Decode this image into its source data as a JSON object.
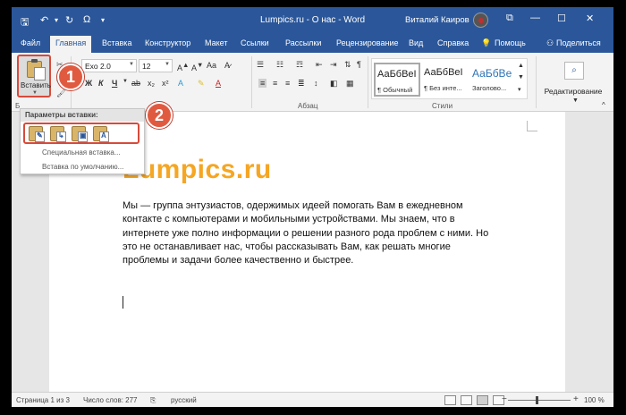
{
  "titlebar": {
    "title": "Lumpics.ru - О нас - Word",
    "user": "Виталий Каиров",
    "save_icon": "save-icon",
    "undo_icon": "undo-icon",
    "redo_icon": "redo-icon",
    "symbol_icon": "Ω",
    "accent": "#2b579a"
  },
  "tabs": {
    "items": [
      "Файл",
      "Главная",
      "Вставка",
      "Конструктор",
      "Макет",
      "Ссылки",
      "Рассылки",
      "Рецензирование",
      "Вид",
      "Справка"
    ],
    "active": "Главная",
    "tell_me": "Помощь",
    "share": "Поделиться"
  },
  "ribbon": {
    "paste_label": "Вставить",
    "font_name": "Exo 2.0",
    "font_size": "12",
    "bold": "Ж",
    "italic": "К",
    "underline": "Ч",
    "paragraph_group": "Абзац",
    "styles_group": "Стили",
    "styles": [
      {
        "sample": "АаБбВеI",
        "name": "¶ Обычный"
      },
      {
        "sample": "АаБбВеI",
        "name": "¶ Без инте..."
      },
      {
        "sample": "АаБбВе",
        "name": "Заголово..."
      }
    ],
    "editing_label": "Редактирование",
    "callouts": [
      "1",
      "2"
    ]
  },
  "paste_menu": {
    "header": "Параметры вставки:",
    "options": [
      "Сохранить исходное форматирование",
      "Объединить форматирование",
      "Рисунок",
      "Сохранить только текст"
    ],
    "special": "Специальная вставка...",
    "default": "Вставка по умолчанию..."
  },
  "document": {
    "heading": "Lumpics.ru",
    "paragraph": "Мы — группа энтузиастов, одержимых идеей помогать Вам в ежедневном контакте с компьютерами и мобильными устройствами. Мы знаем, что в интернете уже полно информации о решении разного рода проблем с ними. Но это не останавливает нас, чтобы рассказывать Вам, как решать многие проблемы и задачи более качественно и быстрее.",
    "heading_color": "#f5a623"
  },
  "statusbar": {
    "page": "Страница 1 из 3",
    "words": "Число слов: 277",
    "language": "русский",
    "zoom": "100 %",
    "minus": "−",
    "plus": "+"
  }
}
